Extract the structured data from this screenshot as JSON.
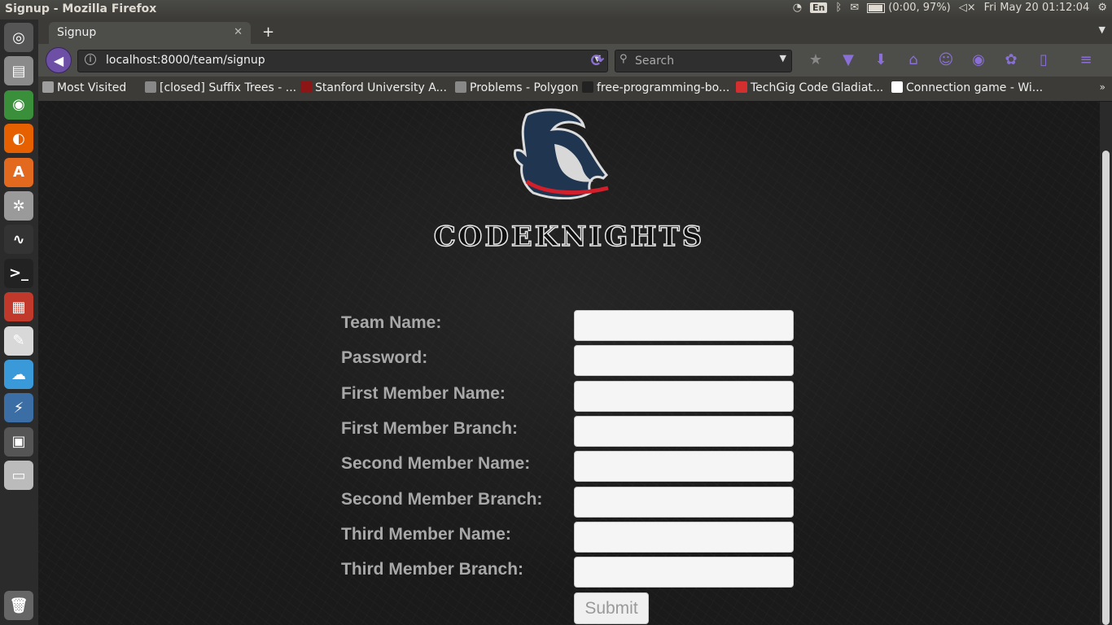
{
  "window": {
    "title": "Signup - Mozilla Firefox"
  },
  "system_tray": {
    "keyboard": "En",
    "battery_text": "(0:00, 97%)",
    "clock": "Fri May 20 01:12:04"
  },
  "tabs": [
    {
      "label": "Signup"
    }
  ],
  "new_tab_symbol": "+",
  "navbar": {
    "url": "localhost:8000/team/signup",
    "search_placeholder": "Search"
  },
  "bookmarks": [
    {
      "label": "Most Visited",
      "icon": "folder-icon",
      "color": "#9e9e9e"
    },
    {
      "label": "[closed] Suffix Trees - ...",
      "icon": "globe-icon",
      "color": "#888888"
    },
    {
      "label": "Stanford University A...",
      "icon": "stanford-icon",
      "color": "#8c1515"
    },
    {
      "label": "Problems - Polygon",
      "icon": "globe-icon",
      "color": "#888888"
    },
    {
      "label": "free-programming-bo...",
      "icon": "github-icon",
      "color": "#222222"
    },
    {
      "label": "TechGig Code Gladiat...",
      "icon": "techgig-icon",
      "color": "#d32f2f"
    },
    {
      "label": "Connection game - Wi...",
      "icon": "wikipedia-icon",
      "color": "#ffffff"
    }
  ],
  "page": {
    "brand": "CODEKNIGHTS",
    "form": {
      "fields": [
        {
          "label": "Team Name:",
          "value": ""
        },
        {
          "label": "Password:",
          "value": ""
        },
        {
          "label": "First Member Name:",
          "value": ""
        },
        {
          "label": "First Member Branch:",
          "value": ""
        },
        {
          "label": "Second Member Name:",
          "value": ""
        },
        {
          "label": "Second Member Branch:",
          "value": ""
        },
        {
          "label": "Third Member Name:",
          "value": ""
        },
        {
          "label": "Third Member Branch:",
          "value": ""
        }
      ],
      "submit_label": "Submit"
    }
  },
  "launcher_apps": [
    {
      "name": "ubuntu-dash-icon",
      "color": "#555555",
      "glyph": "◎"
    },
    {
      "name": "files-icon",
      "color": "#8a8a8a",
      "glyph": "▤"
    },
    {
      "name": "chrome-icon",
      "color": "#3a8f3a",
      "glyph": "◉"
    },
    {
      "name": "firefox-icon",
      "color": "#e66000",
      "glyph": "◐"
    },
    {
      "name": "software-center-icon",
      "color": "#e3691f",
      "glyph": "A"
    },
    {
      "name": "system-settings-icon",
      "color": "#9a9a9a",
      "glyph": "✲"
    },
    {
      "name": "system-monitor-icon",
      "color": "#333333",
      "glyph": "∿"
    },
    {
      "name": "terminal-icon",
      "color": "#222222",
      "glyph": ">_"
    },
    {
      "name": "workspaces-icon",
      "color": "#c0392b",
      "glyph": "▦"
    },
    {
      "name": "text-editor-icon",
      "color": "#d8d8d8",
      "glyph": "✎"
    },
    {
      "name": "mindmap-icon",
      "color": "#3a9ad9",
      "glyph": "☁"
    },
    {
      "name": "python-icon",
      "color": "#3b6ea5",
      "glyph": "⚡"
    },
    {
      "name": "app-icon",
      "color": "#555555",
      "glyph": "▣"
    },
    {
      "name": "drive-icon",
      "color": "#bbbbbb",
      "glyph": "▭"
    },
    {
      "name": "trash-icon",
      "color": "#666666",
      "glyph": "🗑"
    }
  ]
}
